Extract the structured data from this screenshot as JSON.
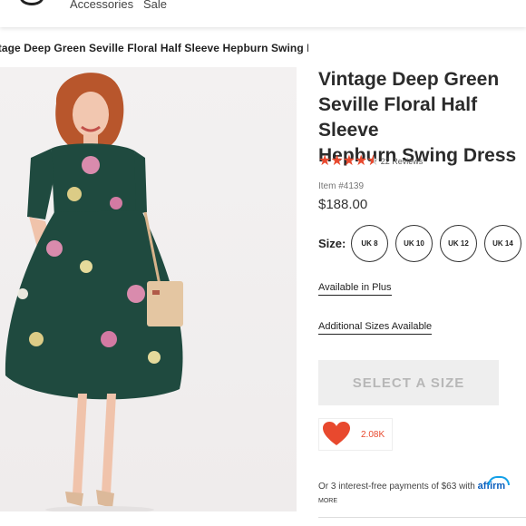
{
  "nav": {
    "links": [
      "Accessories",
      "Sale"
    ]
  },
  "breadcrumb": "Vintage Deep Green Seville Floral Half Sleeve Hepburn Swing Dress",
  "product": {
    "title": "Vintage Deep Green\nSeville Floral Half Sleeve\nHepburn Swing Dress",
    "rating": 4.5,
    "reviews_label": "22 Reviews",
    "item_number": "Item #4139",
    "price": "$188.00",
    "image_alt": "Woman modeling deep green floral half sleeve swing dress with tan handbag"
  },
  "sizes": {
    "label": "Size:",
    "options": [
      "UK 8",
      "UK 10",
      "UK 12",
      "UK 14"
    ]
  },
  "links": {
    "plus": "Available in Plus",
    "additional": "Additional Sizes Available"
  },
  "cta": {
    "select_label": "SELECT A SIZE"
  },
  "favorite": {
    "count": "2.08K"
  },
  "affirm": {
    "text": "Or 3 interest-free payments of $63 with",
    "brand": "affirm",
    "more": "MORE"
  },
  "colors": {
    "accent": "#e8492e",
    "dress": "#1f4a3f",
    "affirm_blue": "#0a5ebd"
  },
  "icons": {
    "favorite": "heart-icon",
    "rating": "star-icon",
    "logo": "brand-logo"
  }
}
